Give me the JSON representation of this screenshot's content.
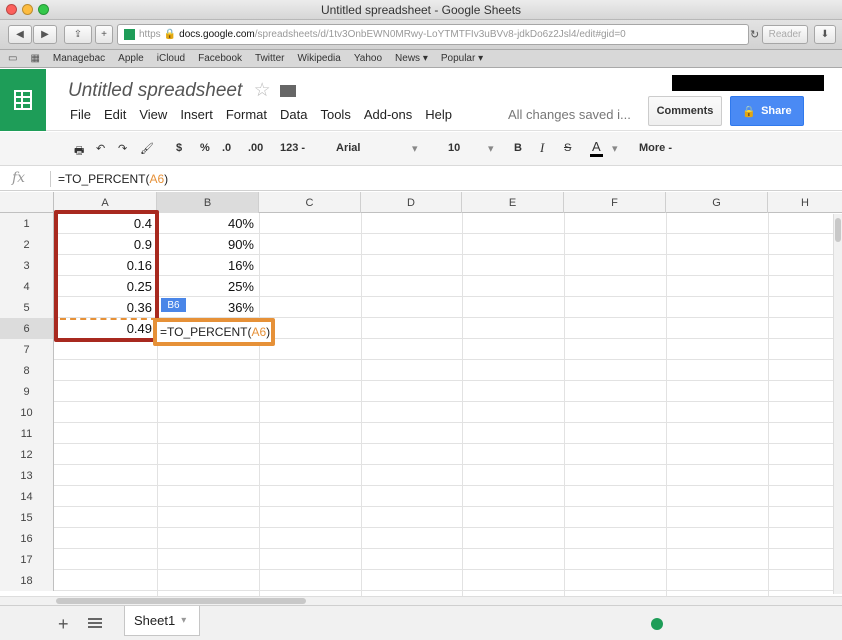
{
  "window": {
    "title": "Untitled spreadsheet - Google Sheets"
  },
  "browser": {
    "url_prefix": "https",
    "url_host": "docs.google.com",
    "url_path": "/spreadsheets/d/1tv3OnbEWN0MRwy-LoYTMTFIv3uBVv8-jdkDo6z2Jsl4/edit#gid=0",
    "reader_label": "Reader",
    "bookmarks": [
      "Managebac",
      "Apple",
      "iCloud",
      "Facebook",
      "Twitter",
      "Wikipedia",
      "Yahoo",
      "News ▾",
      "Popular ▾"
    ]
  },
  "doc": {
    "title": "Untitled spreadsheet",
    "menus": [
      "File",
      "Edit",
      "View",
      "Insert",
      "Format",
      "Data",
      "Tools",
      "Add-ons",
      "Help"
    ],
    "save_status": "All changes saved i...",
    "comments_label": "Comments",
    "share_label": "Share"
  },
  "format_toolbar": {
    "currency": "$",
    "percent": "%",
    "dec_less": ".0",
    "dec_more": ".00",
    "more_formats": "123 -",
    "font": "Arial",
    "font_size": "10",
    "bold": "B",
    "italic": "I",
    "strike": "S",
    "text_color": "A",
    "more": "More -"
  },
  "formula_bar": {
    "fx_label": "fx",
    "formula_prefix": "=TO_PERCENT(",
    "formula_ref": "A6",
    "formula_suffix": ")"
  },
  "grid": {
    "columns": [
      "A",
      "B",
      "C",
      "D",
      "E",
      "F",
      "G",
      "H"
    ],
    "rows": [
      "1",
      "2",
      "3",
      "4",
      "5",
      "6",
      "7",
      "8",
      "9",
      "10",
      "11",
      "12",
      "13",
      "14",
      "15",
      "16",
      "17",
      "18"
    ],
    "col_a": [
      "0.4",
      "0.9",
      "0.16",
      "0.25",
      "0.36",
      "0.49"
    ],
    "col_b": [
      "40%",
      "90%",
      "16%",
      "25%",
      "36%",
      ""
    ],
    "cell_tag": "B6"
  },
  "sheets": {
    "add": "+",
    "tab_label": "Sheet1",
    "tab_arrow": "▾"
  },
  "colors": {
    "sheets_green": "#1e9d58",
    "share_blue": "#4a8af4",
    "highlight_red": "#a8291f",
    "highlight_orange": "#e69138",
    "ref_orange": "#e69138"
  }
}
